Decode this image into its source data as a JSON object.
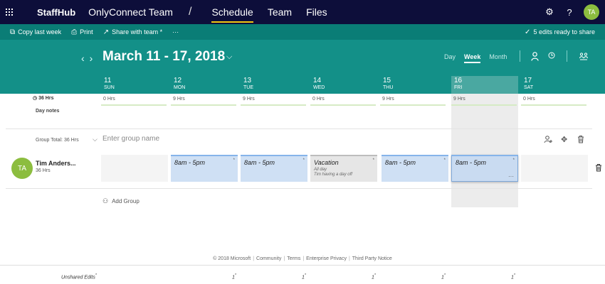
{
  "topbar": {
    "brand": "StaffHub",
    "team": "OnlyConnect Team",
    "separator": "/",
    "nav": [
      {
        "label": "Schedule",
        "active": true
      },
      {
        "label": "Team",
        "active": false
      },
      {
        "label": "Files",
        "active": false
      }
    ],
    "user_initials": "TA",
    "icons": [
      "waffle-icon",
      "gear-icon",
      "help-icon"
    ]
  },
  "commands": {
    "copy_last_week": "Copy last week",
    "print": "Print",
    "share_with_team": "Share with team *",
    "more": "···",
    "edits_ready": "5 edits ready to share"
  },
  "header": {
    "date_range": "March 11 - 17, 2018",
    "views": {
      "day": "Day",
      "week": "Week",
      "month": "Month",
      "active": "Week"
    },
    "days": [
      {
        "num": "11",
        "name": "SUN",
        "hrs": "0 Hrs"
      },
      {
        "num": "12",
        "name": "MON",
        "hrs": "9 Hrs"
      },
      {
        "num": "13",
        "name": "TUE",
        "hrs": "9 Hrs"
      },
      {
        "num": "14",
        "name": "WED",
        "hrs": "0 Hrs"
      },
      {
        "num": "15",
        "name": "THU",
        "hrs": "9 Hrs"
      },
      {
        "num": "16",
        "name": "FRI",
        "hrs": "9 Hrs"
      },
      {
        "num": "17",
        "name": "SAT",
        "hrs": "0 Hrs"
      }
    ]
  },
  "summary": {
    "total_hrs": "36 Hrs",
    "day_notes": "Day notes"
  },
  "group": {
    "total": "Group Total: 36 Hrs",
    "name_placeholder": "Enter group name"
  },
  "member": {
    "initials": "TA",
    "name": "Tim Anders...",
    "hrs": "36 Hrs"
  },
  "shifts": [
    {
      "day": "MON",
      "title": "8am - 5pm",
      "star": "*"
    },
    {
      "day": "TUE",
      "title": "8am - 5pm",
      "star": "*"
    },
    {
      "day": "WED",
      "title": "Vacation",
      "sub1": "All day",
      "sub2": "Tim having a day off",
      "star": "*"
    },
    {
      "day": "THU",
      "title": "8am - 5pm",
      "star": "*"
    },
    {
      "day": "FRI",
      "title": "8am - 5pm",
      "star": "*",
      "more": "···"
    }
  ],
  "add_group": "Add Group",
  "footer": {
    "copyright": "© 2018 Microsoft",
    "community": "Community",
    "terms": "Terms",
    "privacy": "Enterprise Privacy",
    "third_party": "Third Party Notice"
  },
  "unshared": {
    "label": "Unshared Edits",
    "star": "*",
    "counts": [
      "1",
      "1",
      "1",
      "1",
      "1"
    ]
  }
}
